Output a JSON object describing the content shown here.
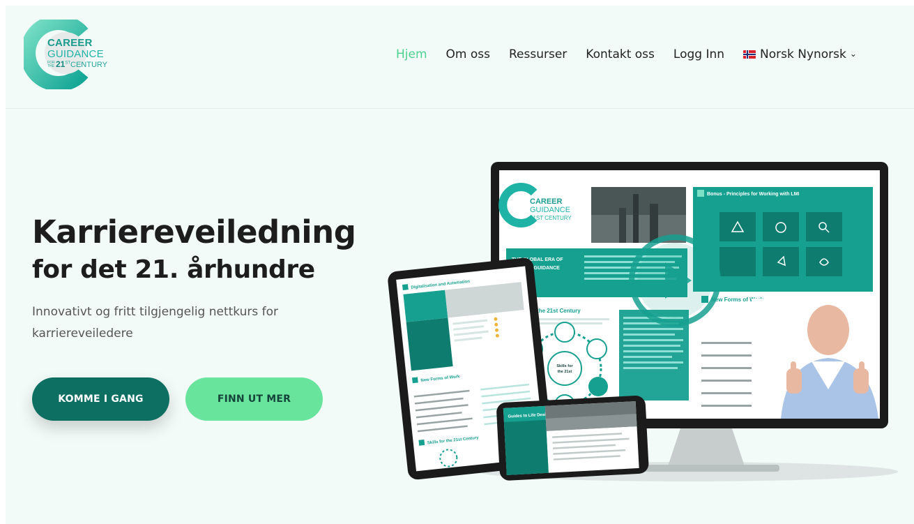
{
  "logo": {
    "line1": "CAREER",
    "line2": "GUIDANCE",
    "line3_prefix": "FOR THE",
    "line3_num": "21",
    "line3_sup": "ST",
    "line3_suffix": "CENTURY"
  },
  "nav": {
    "items": [
      {
        "label": "Hjem",
        "active": true
      },
      {
        "label": "Om oss",
        "active": false
      },
      {
        "label": "Ressurser",
        "active": false
      },
      {
        "label": "Kontakt oss",
        "active": false
      },
      {
        "label": "Logg Inn",
        "active": false
      }
    ],
    "language": "Norsk Nynorsk"
  },
  "hero": {
    "title_line1": "Karriereveiledning",
    "title_line2": "for det 21. århundre",
    "subtitle": "Innovativt og fritt tilgjengelig nettkurs for karriereveiledere",
    "primary_button": "KOMME I GANG",
    "secondary_button": "FINN UT MER"
  },
  "illustration": {
    "monitor_title_left": "THE GLOBAL ERA OF CAREER GUIDANCE",
    "monitor_panel_title": "Bonus - Principles for Working with LMI",
    "monitor_section1": "Skills for the 21st Century",
    "monitor_section2": "New Forms of Work",
    "monitor_hub": "Skills for the 21st century",
    "tablet_title": "Digitalisation and Automation",
    "tablet_section": "New Forms of Work",
    "tablet_section2": "Skills for the 21st Century",
    "phone_title": "Guides to Life Design"
  },
  "colors": {
    "accent_green": "#4cd28f",
    "primary_teal": "#0d6e62",
    "secondary_green": "#69e49d",
    "brand_teal": "#1fb3a6"
  }
}
